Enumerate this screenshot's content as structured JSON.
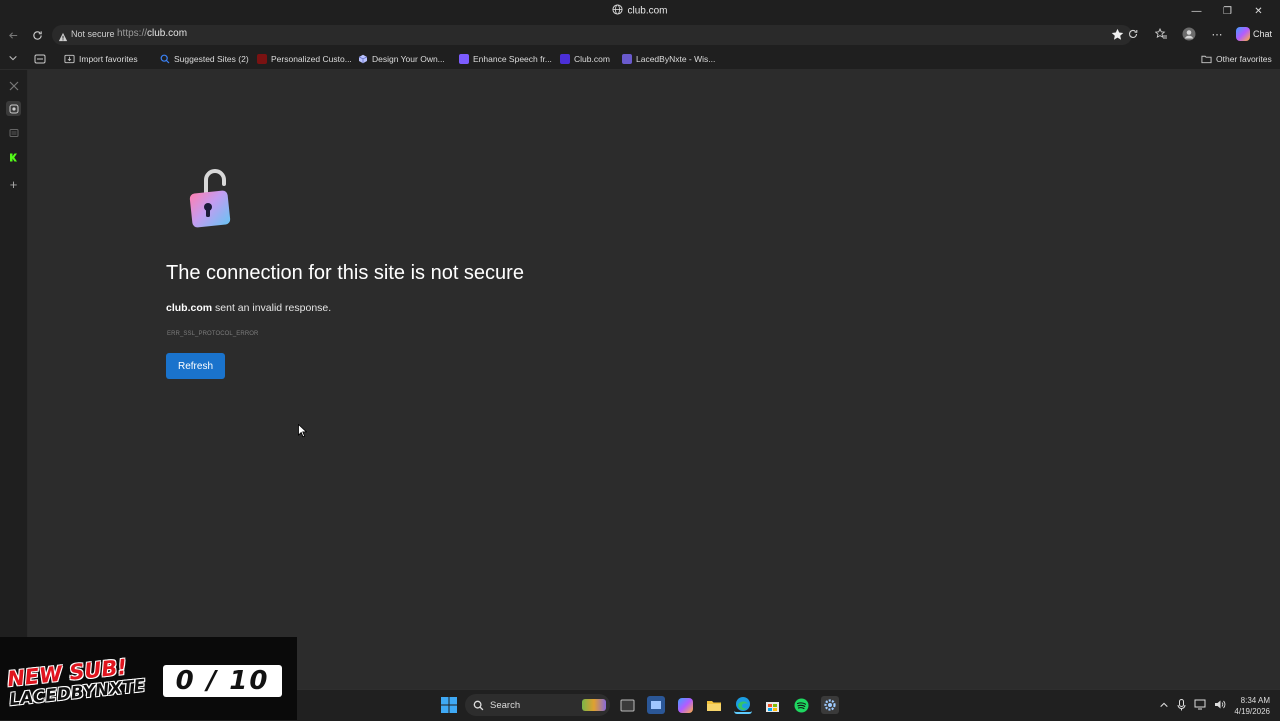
{
  "window": {
    "title": "club.com"
  },
  "address_bar": {
    "security_label": "Not secure",
    "url_scheme": "https://",
    "url_host": "club.com"
  },
  "toolbar": {
    "chat_label": "Chat"
  },
  "favorites": [
    {
      "label": "Import favorites",
      "color": "#cfcfcf"
    },
    {
      "label": "Suggested Sites (2)",
      "color": "#3b82f6"
    },
    {
      "label": "Personalized Custo...",
      "color": "#8b1a1a"
    },
    {
      "label": "Design Your Own...",
      "color": "#9aa8ff"
    },
    {
      "label": "Enhance Speech fr...",
      "color": "#7c5cff"
    },
    {
      "label": "Club.com",
      "color": "#4b2fd8"
    },
    {
      "label": "LacedByNxte - Wis...",
      "color": "#6a5acd"
    }
  ],
  "other_favorites": "Other favorites",
  "error": {
    "title": "The connection for this site is not secure",
    "host": "club.com",
    "message": " sent an invalid response.",
    "code": "ERR_SSL_PROTOCOL_ERROR",
    "button": "Refresh"
  },
  "overlay": {
    "line1": "NEW SUB!",
    "line2": "LACEDBYNXTE",
    "counter": "0 / 10"
  },
  "taskbar": {
    "search_placeholder": "Search",
    "time": "8:34 AM",
    "date": "4/19/2026"
  },
  "colors": {
    "accent": "#1a73cc",
    "page_bg": "#2c2c2c",
    "chrome_bg": "#1f1f1f"
  }
}
